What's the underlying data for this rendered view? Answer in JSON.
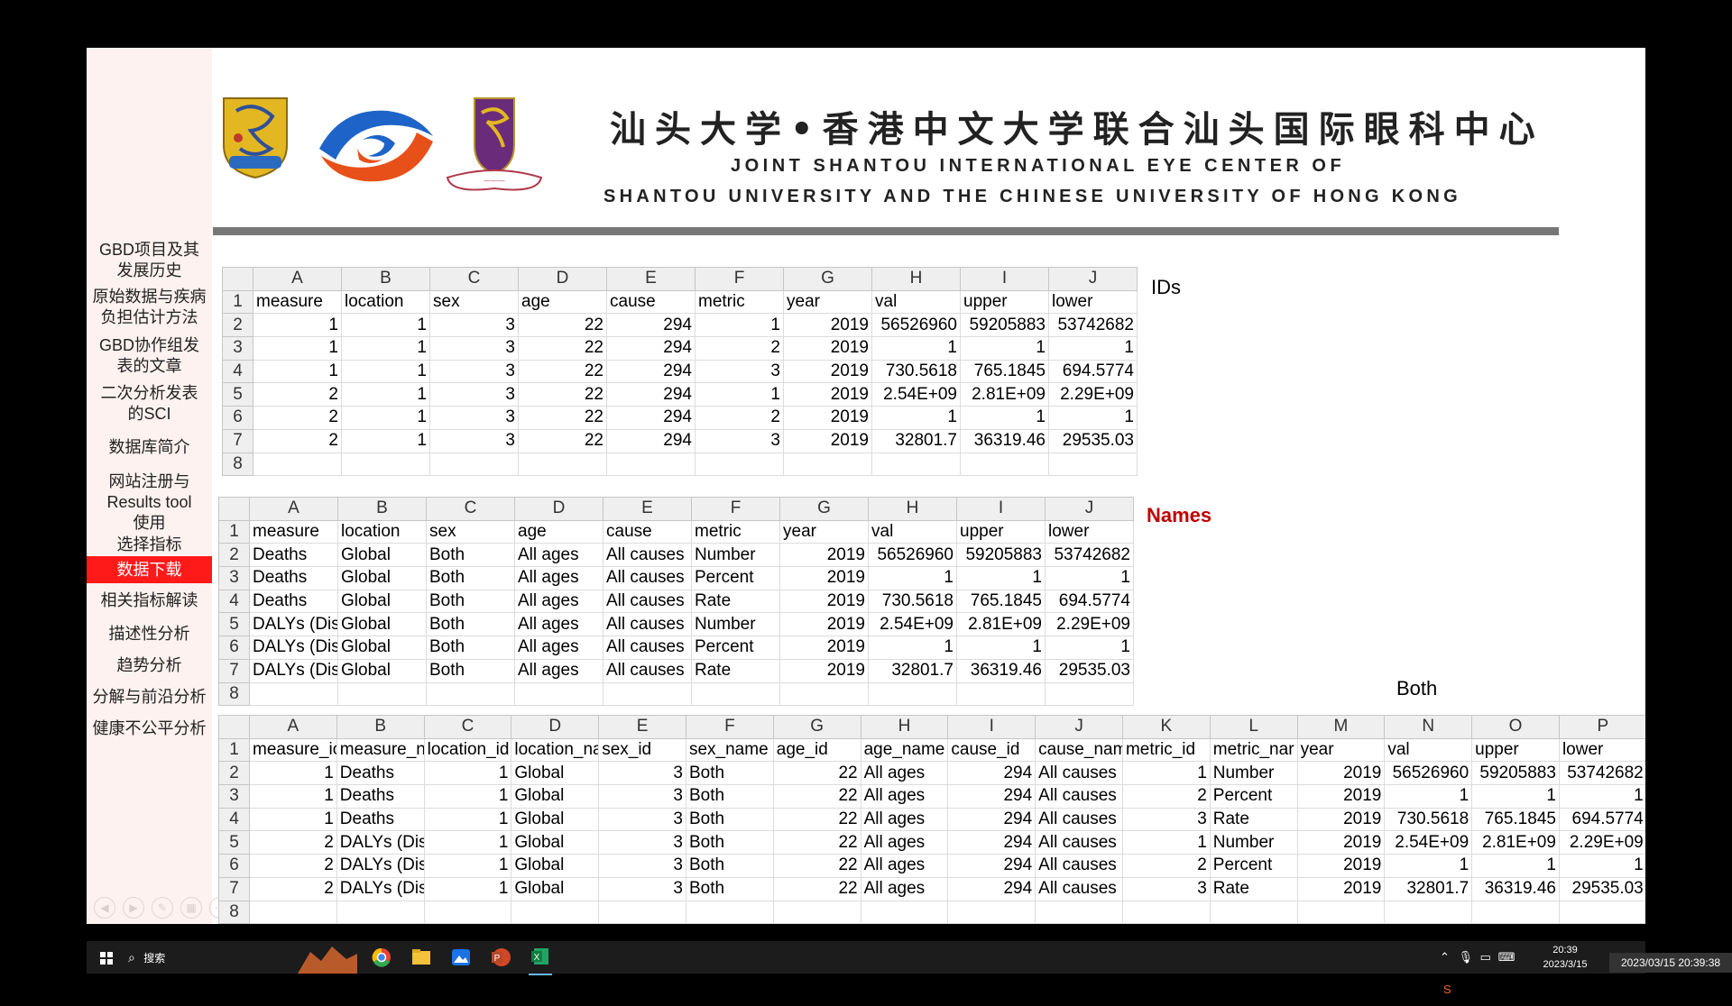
{
  "header": {
    "title_cn": "汕头大学•香港中文大学联合汕头国际眼科中心",
    "title_en_line1": "JOINT SHANTOU INTERNATIONAL EYE CENTER OF",
    "title_en_line2": "SHANTOU UNIVERSITY AND THE CHINESE UNIVERSITY OF HONG KONG"
  },
  "colors": {
    "accent": "#ff1a1a",
    "sidebar_bg": "#fdf2ef",
    "names_label": "#c00000",
    "header_bar": "#777777"
  },
  "sidebar": {
    "items": [
      {
        "label": "GBD项目及其\n发展历史"
      },
      {
        "label": "原始数据与疾病\n负担估计方法"
      },
      {
        "label": "GBD协作组发\n表的文章"
      },
      {
        "label": "二次分析发表\n的SCI"
      },
      {
        "label": "数据库简介"
      },
      {
        "label": "网站注册与\nResults tool\n使用"
      },
      {
        "label": "选择指标"
      },
      {
        "label": "数据下载"
      },
      {
        "label": "相关指标解读"
      },
      {
        "label": "描述性分析"
      },
      {
        "label": "趋势分析"
      },
      {
        "label": "分解与前沿分析"
      },
      {
        "label": "健康不公平分析"
      }
    ],
    "active": "数据下载"
  },
  "labels": {
    "ids": "IDs",
    "names": "Names",
    "both": "Both"
  },
  "sheets": {
    "ids": {
      "columns": [
        "A",
        "B",
        "C",
        "D",
        "E",
        "F",
        "G",
        "H",
        "I",
        "J"
      ],
      "rows": [
        {
          "n": "1",
          "cells": [
            "measure",
            "location",
            "sex",
            "age",
            "cause",
            "metric",
            "year",
            "val",
            "upper",
            "lower"
          ]
        },
        {
          "n": "2",
          "cells": [
            "1",
            "1",
            "3",
            "22",
            "294",
            "1",
            "2019",
            "56526960",
            "59205883",
            "53742682"
          ]
        },
        {
          "n": "3",
          "cells": [
            "1",
            "1",
            "3",
            "22",
            "294",
            "2",
            "2019",
            "1",
            "1",
            "1"
          ]
        },
        {
          "n": "4",
          "cells": [
            "1",
            "1",
            "3",
            "22",
            "294",
            "3",
            "2019",
            "730.5618",
            "765.1845",
            "694.5774"
          ]
        },
        {
          "n": "5",
          "cells": [
            "2",
            "1",
            "3",
            "22",
            "294",
            "1",
            "2019",
            "2.54E+09",
            "2.81E+09",
            "2.29E+09"
          ]
        },
        {
          "n": "6",
          "cells": [
            "2",
            "1",
            "3",
            "22",
            "294",
            "2",
            "2019",
            "1",
            "1",
            "1"
          ]
        },
        {
          "n": "7",
          "cells": [
            "2",
            "1",
            "3",
            "22",
            "294",
            "3",
            "2019",
            "32801.7",
            "36319.46",
            "29535.03"
          ]
        },
        {
          "n": "8",
          "cells": [
            "",
            "",
            "",
            "",
            "",
            "",
            "",
            "",
            "",
            ""
          ]
        }
      ]
    },
    "names": {
      "columns": [
        "A",
        "B",
        "C",
        "D",
        "E",
        "F",
        "G",
        "H",
        "I",
        "J"
      ],
      "rows": [
        {
          "n": "1",
          "cells": [
            "measure",
            "location",
            "sex",
            "age",
            "cause",
            "metric",
            "year",
            "val",
            "upper",
            "lower"
          ]
        },
        {
          "n": "2",
          "cells": [
            "Deaths",
            "Global",
            "Both",
            "All ages",
            "All causes",
            "Number",
            "2019",
            "56526960",
            "59205883",
            "53742682"
          ]
        },
        {
          "n": "3",
          "cells": [
            "Deaths",
            "Global",
            "Both",
            "All ages",
            "All causes",
            "Percent",
            "2019",
            "1",
            "1",
            "1"
          ]
        },
        {
          "n": "4",
          "cells": [
            "Deaths",
            "Global",
            "Both",
            "All ages",
            "All causes",
            "Rate",
            "2019",
            "730.5618",
            "765.1845",
            "694.5774"
          ]
        },
        {
          "n": "5",
          "cells": [
            "DALYs (Dis",
            "Global",
            "Both",
            "All ages",
            "All causes",
            "Number",
            "2019",
            "2.54E+09",
            "2.81E+09",
            "2.29E+09"
          ]
        },
        {
          "n": "6",
          "cells": [
            "DALYs (Dis",
            "Global",
            "Both",
            "All ages",
            "All causes",
            "Percent",
            "2019",
            "1",
            "1",
            "1"
          ]
        },
        {
          "n": "7",
          "cells": [
            "DALYs (Dis",
            "Global",
            "Both",
            "All ages",
            "All causes",
            "Rate",
            "2019",
            "32801.7",
            "36319.46",
            "29535.03"
          ]
        },
        {
          "n": "8",
          "cells": [
            "",
            "",
            "",
            "",
            "",
            "",
            "",
            "",
            "",
            ""
          ]
        }
      ]
    },
    "both": {
      "columns": [
        "A",
        "B",
        "C",
        "D",
        "E",
        "F",
        "G",
        "H",
        "I",
        "J",
        "K",
        "L",
        "M",
        "N",
        "O",
        "P"
      ],
      "rows": [
        {
          "n": "1",
          "cells": [
            "measure_ic",
            "measure_n",
            "location_id",
            "location_na",
            "sex_id",
            "sex_name",
            "age_id",
            "age_name",
            "cause_id",
            "cause_nam",
            "metric_id",
            "metric_nar",
            "year",
            "val",
            "upper",
            "lower"
          ]
        },
        {
          "n": "2",
          "cells": [
            "1",
            "Deaths",
            "1",
            "Global",
            "3",
            "Both",
            "22",
            "All ages",
            "294",
            "All causes",
            "1",
            "Number",
            "2019",
            "56526960",
            "59205883",
            "53742682"
          ]
        },
        {
          "n": "3",
          "cells": [
            "1",
            "Deaths",
            "1",
            "Global",
            "3",
            "Both",
            "22",
            "All ages",
            "294",
            "All causes",
            "2",
            "Percent",
            "2019",
            "1",
            "1",
            "1"
          ]
        },
        {
          "n": "4",
          "cells": [
            "1",
            "Deaths",
            "1",
            "Global",
            "3",
            "Both",
            "22",
            "All ages",
            "294",
            "All causes",
            "3",
            "Rate",
            "2019",
            "730.5618",
            "765.1845",
            "694.5774"
          ]
        },
        {
          "n": "5",
          "cells": [
            "2",
            "DALYs (Dis",
            "1",
            "Global",
            "3",
            "Both",
            "22",
            "All ages",
            "294",
            "All causes",
            "1",
            "Number",
            "2019",
            "2.54E+09",
            "2.81E+09",
            "2.29E+09"
          ]
        },
        {
          "n": "6",
          "cells": [
            "2",
            "DALYs (Dis",
            "1",
            "Global",
            "3",
            "Both",
            "22",
            "All ages",
            "294",
            "All causes",
            "2",
            "Percent",
            "2019",
            "1",
            "1",
            "1"
          ]
        },
        {
          "n": "7",
          "cells": [
            "2",
            "DALYs (Dis",
            "1",
            "Global",
            "3",
            "Both",
            "22",
            "All ages",
            "294",
            "All causes",
            "3",
            "Rate",
            "2019",
            "32801.7",
            "36319.46",
            "29535.03"
          ]
        },
        {
          "n": "8",
          "cells": [
            "",
            "",
            "",
            "",
            "",
            "",
            "",
            "",
            "",
            "",
            "",
            "",
            "",
            "",
            "",
            ""
          ]
        }
      ]
    }
  },
  "taskbar": {
    "search_placeholder": "搜索",
    "time": "20:39",
    "date": "2023/3/15",
    "overlay_datetime": "2023/03/15 20:39:38",
    "apps": [
      "chrome-icon",
      "file-explorer-icon",
      "photos-icon",
      "powerpoint-icon",
      "excel-icon"
    ]
  }
}
